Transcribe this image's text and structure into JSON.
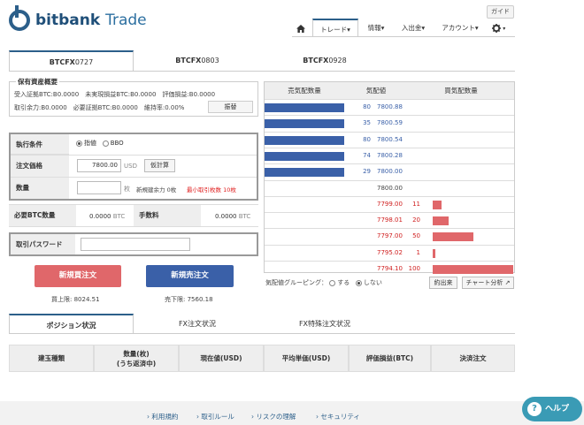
{
  "header": {
    "logo_main": "bitbank",
    "logo_sub": "Trade",
    "guide": "ガイド",
    "nav": [
      "トレード▾",
      "情報▾",
      "入出金▾",
      "アカウント▾"
    ]
  },
  "tabs": [
    {
      "bold": "BTCFX",
      "rest": "0727"
    },
    {
      "bold": "BTCFX",
      "rest": "0803"
    },
    {
      "bold": "BTCFX",
      "rest": "0928"
    }
  ],
  "assets": {
    "title": "保有資産概要",
    "row1": "受入証拠BTC:B0.0000　未実現損益BTC:B0.0000　評価損益:B0.0000",
    "row2": "取引余力:B0.0000　必要証拠BTC:B0.0000　維持率:0.00%",
    "transfer": "振替"
  },
  "form": {
    "exec_label": "執行条件",
    "opt_limit": "指値",
    "opt_bbo": "BBO",
    "price_label": "注文価格",
    "price_value": "7800.00",
    "price_unit": "USD",
    "calc": "仮計算",
    "qty_label": "数量",
    "qty_unit": "枚",
    "new_remaining": "新規建余力 0枚",
    "min_qty": "最小取引枚数 10枚",
    "btc_req_label": "必要BTC数量",
    "btc_req_value": "0.0000",
    "btc_unit": "BTC",
    "fee_label": "手数料",
    "fee_value": "0.0000",
    "pw_label": "取引パスワード"
  },
  "buttons": {
    "buy": "新規買注文",
    "sell": "新規売注文",
    "buy_limit": "買上限: 8024.51",
    "sell_limit": "売下限: 7560.18"
  },
  "book": {
    "head_sell": "売気配数量",
    "head_price": "気配値",
    "head_buy": "買気配数量",
    "grouping": "気配値グルーピング：",
    "opt_on": "する",
    "opt_off": "しない",
    "trade_btn": "約出来",
    "chart_btn": "チャート分析 ↗",
    "sell_color": "#3a60a8",
    "buy_color": "#e0676a"
  },
  "chart_data": {
    "type": "bar",
    "asks": [
      {
        "qty": "80",
        "price": "7800.88"
      },
      {
        "qty": "35",
        "price": "7800.59"
      },
      {
        "qty": "80",
        "price": "7800.54"
      },
      {
        "qty": "74",
        "price": "7800.28"
      },
      {
        "qty": "29",
        "price": "7800.00"
      }
    ],
    "mid": "7800.00",
    "bids": [
      {
        "price": "7799.00",
        "qty": "11"
      },
      {
        "price": "7798.01",
        "qty": "20"
      },
      {
        "price": "7797.00",
        "qty": "50"
      },
      {
        "price": "7795.02",
        "qty": "1"
      },
      {
        "price": "7794.10",
        "qty": "100"
      }
    ]
  },
  "positions": {
    "tabs": [
      "ポジション状況",
      "FX注文状況",
      "FX特殊注文状況"
    ],
    "cols": [
      "建玉種類",
      "数量(枚)\n(うち返済中)",
      "現在値(USD)",
      "平均単価(USD)",
      "評価損益(BTC)",
      "決済注文"
    ]
  },
  "footer": {
    "links": [
      "› 利用規約",
      "› 取引ルール",
      "› リスクの理解",
      "› セキュリティ"
    ],
    "help": "ヘルプ"
  }
}
